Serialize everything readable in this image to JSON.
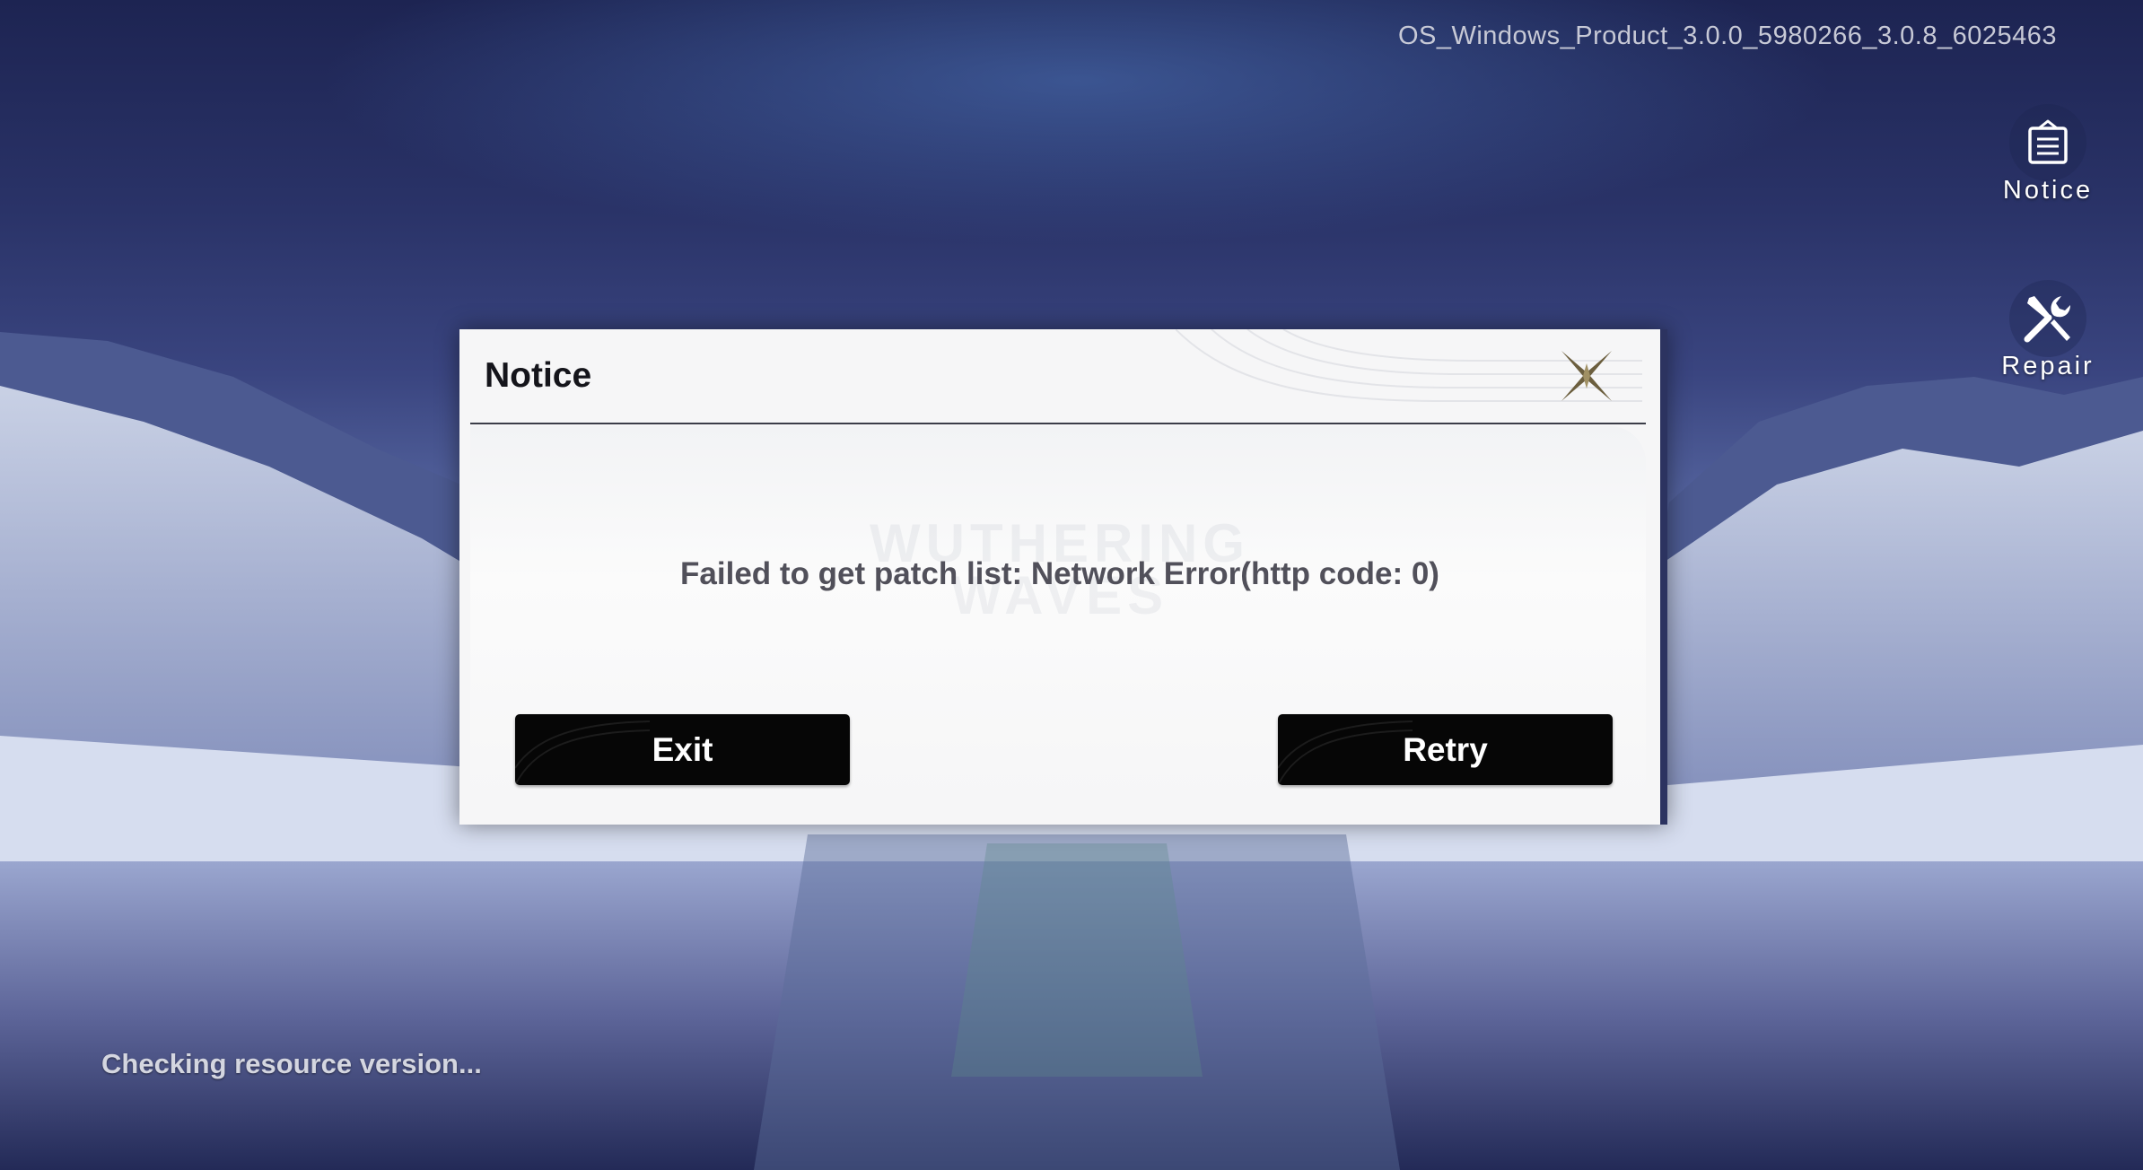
{
  "app": {
    "version": "OS_Windows_Product_3.0.0_5980266_3.0.8_6025463",
    "status_text": "Checking resource version..."
  },
  "side_buttons": {
    "notice": {
      "label": "Notice",
      "icon": "notice-icon"
    },
    "repair": {
      "label": "Repair",
      "icon": "wrench-screwdriver-icon"
    }
  },
  "dialog": {
    "title": "Notice",
    "message": "Failed to get patch list: Network Error(http code: 0)",
    "close_icon": "close-icon",
    "watermark_line1": "WUTHERING",
    "watermark_line2": "WAVES",
    "buttons": {
      "exit_label": "Exit",
      "retry_label": "Retry"
    }
  },
  "colors": {
    "dialog_background": "#f6f6f7",
    "button_background": "#060606",
    "close_accent": "#6b5e3e"
  }
}
